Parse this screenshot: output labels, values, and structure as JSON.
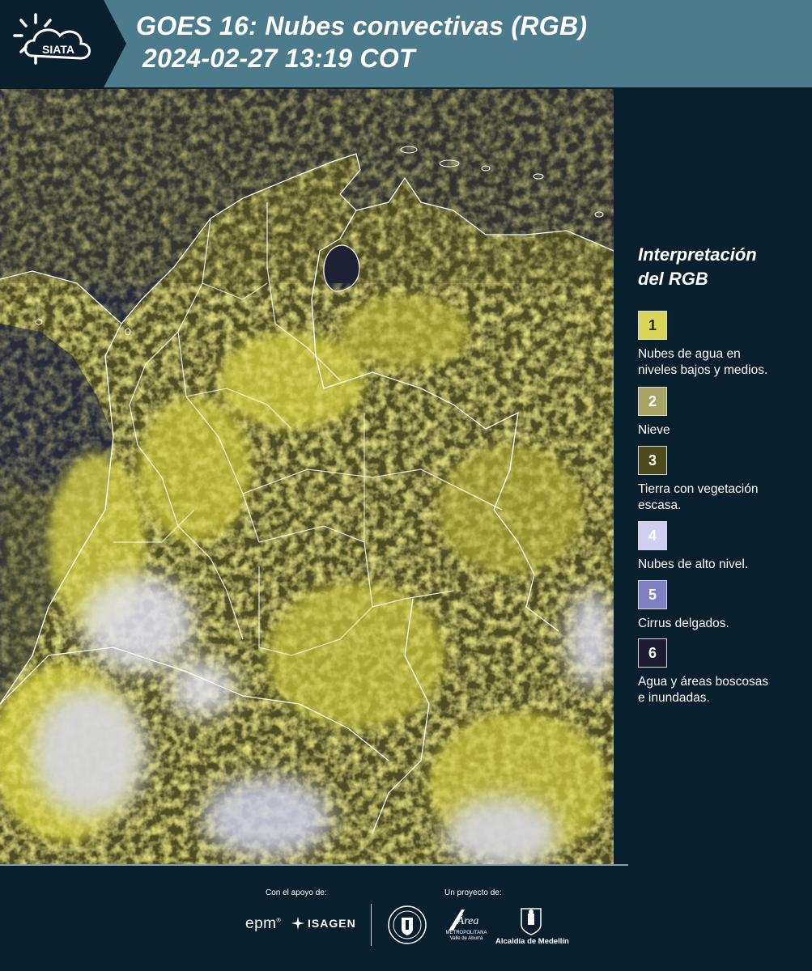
{
  "header": {
    "logo_text": "SIATA",
    "title_line1": "GOES 16: Nubes convectivas (RGB)",
    "title_line2": "2024-02-27 13:19 COT"
  },
  "map": {
    "region": "Colombia",
    "product": "Nubes convectivas (RGB)",
    "colors": {
      "ocean": "#23273a",
      "land_dark": "#4a4a1e",
      "cloud_low": "#d8d640",
      "cloud_high": "#e6e4f0",
      "borders": "#ffffff"
    }
  },
  "legend": {
    "title_line1": "Interpretación",
    "title_line2": "del RGB",
    "items": [
      {
        "num": "1",
        "color": "#d8d65a",
        "num_color": "#2a2a10",
        "text_line1": "Nubes de agua en",
        "text_line2": "niveles bajos y medios."
      },
      {
        "num": "2",
        "color": "#a6a566",
        "num_color": "#ffffff",
        "text_line1": "Nieve",
        "text_line2": ""
      },
      {
        "num": "3",
        "color": "#4d4a1c",
        "num_color": "#ffffff",
        "text_line1": "Tierra con vegetación",
        "text_line2": "escasa."
      },
      {
        "num": "4",
        "color": "#cfd0f0",
        "num_color": "#ffffff",
        "text_line1": "Nubes de alto nivel.",
        "text_line2": ""
      },
      {
        "num": "5",
        "color": "#7f80c2",
        "num_color": "#ffffff",
        "text_line1": "Cirrus delgados.",
        "text_line2": ""
      },
      {
        "num": "6",
        "color": "#1c1c30",
        "num_color": "#ffffff",
        "text_line1": "Agua y áreas boscosas",
        "text_line2": "e inundadas."
      }
    ]
  },
  "footer": {
    "support_label": "Con el apoyo de:",
    "project_label": "Un proyecto de:",
    "sponsor_epm": "epm",
    "sponsor_isagen": "ISAGEN",
    "partner_amva_name": "Área",
    "partner_amva_sub1": "METROPOLITANA",
    "partner_amva_sub2": "Valle de Aburrá",
    "partner_alcaldia": "Alcaldía de Medellín"
  }
}
